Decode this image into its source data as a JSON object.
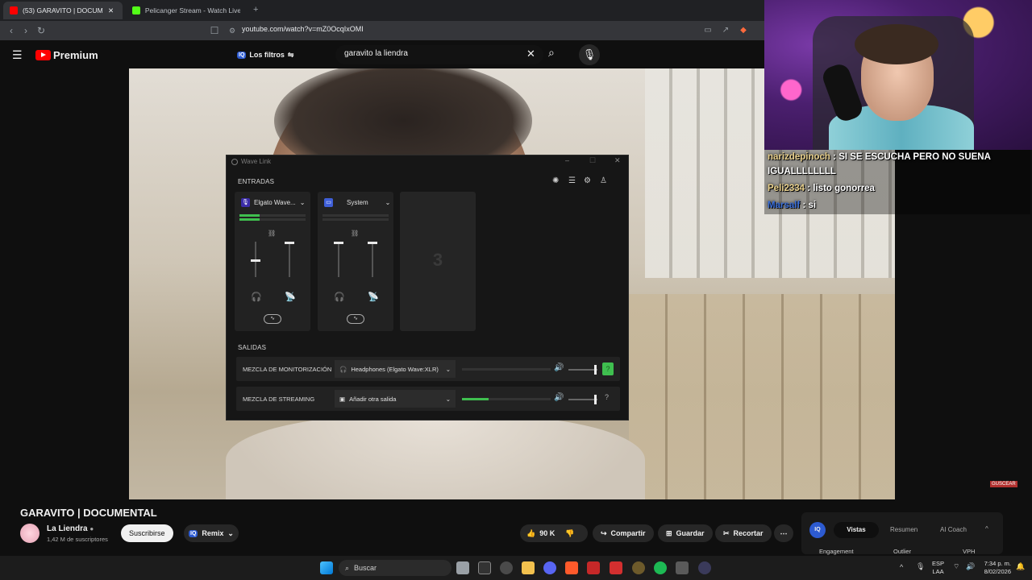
{
  "browser": {
    "tabs": [
      {
        "label": "(53) GARAVITO | DOCUMENTAL",
        "active": true
      },
      {
        "label": "Pelicanger Stream - Watch Live on K",
        "active": false
      }
    ],
    "url": "youtube.com/watch?v=mZ0OcqIxOMI"
  },
  "youtube": {
    "logo_text": "Premium",
    "filters_label": "Los filtros",
    "search_value": "garavito la liendra"
  },
  "video": {
    "watermark": "GUSCEAR"
  },
  "chat": [
    {
      "user": "narizdepinoch",
      "message": "SI SE ESCUCHA PERO NO SUENA IGUALLLLLLLL"
    },
    {
      "user": "Peli2334",
      "message": "listo gonorrea"
    },
    {
      "user": "Marsalf",
      "message": "si"
    }
  ],
  "wavelink": {
    "title": "Wave Link",
    "inputs_label": "ENTRADAS",
    "outputs_label": "SALIDAS",
    "channels": [
      {
        "name": "Elgato Wave...",
        "level": 0.3
      },
      {
        "name": "System",
        "level": 0.0
      }
    ],
    "empty_slot": "3",
    "outputs": [
      {
        "label": "MEZCLA DE MONITORIZACIÓN",
        "device": "Headphones (Elgato Wave:XLR)",
        "level": 0.0
      },
      {
        "label": "MEZCLA DE STREAMING",
        "device": "Añadir otra salida",
        "level": 0.3
      }
    ]
  },
  "video_info": {
    "title": "GARAVITO | DOCUMENTAL",
    "channel": "La Liendra",
    "subscribers": "1,42 M de suscriptores",
    "subscribe_label": "Suscribirse",
    "remix_label": "Remix",
    "likes": "90 K",
    "share_label": "Compartir",
    "save_label": "Guardar",
    "clip_label": "Recortar"
  },
  "vidiq": {
    "tabs": [
      "Vistas",
      "Resumen",
      "AI Coach"
    ],
    "columns": [
      "Engagement",
      "Outlier",
      "VPH"
    ]
  },
  "taskbar": {
    "search_label": "Buscar",
    "lang": "ESP",
    "region": "LAA",
    "time": "7:34 p. m.",
    "date": "8/02/2026"
  },
  "colors": {
    "accent_green": "#3fbf4f",
    "yt_red": "#ff0000",
    "vidiq_blue": "#2d5bd1"
  }
}
